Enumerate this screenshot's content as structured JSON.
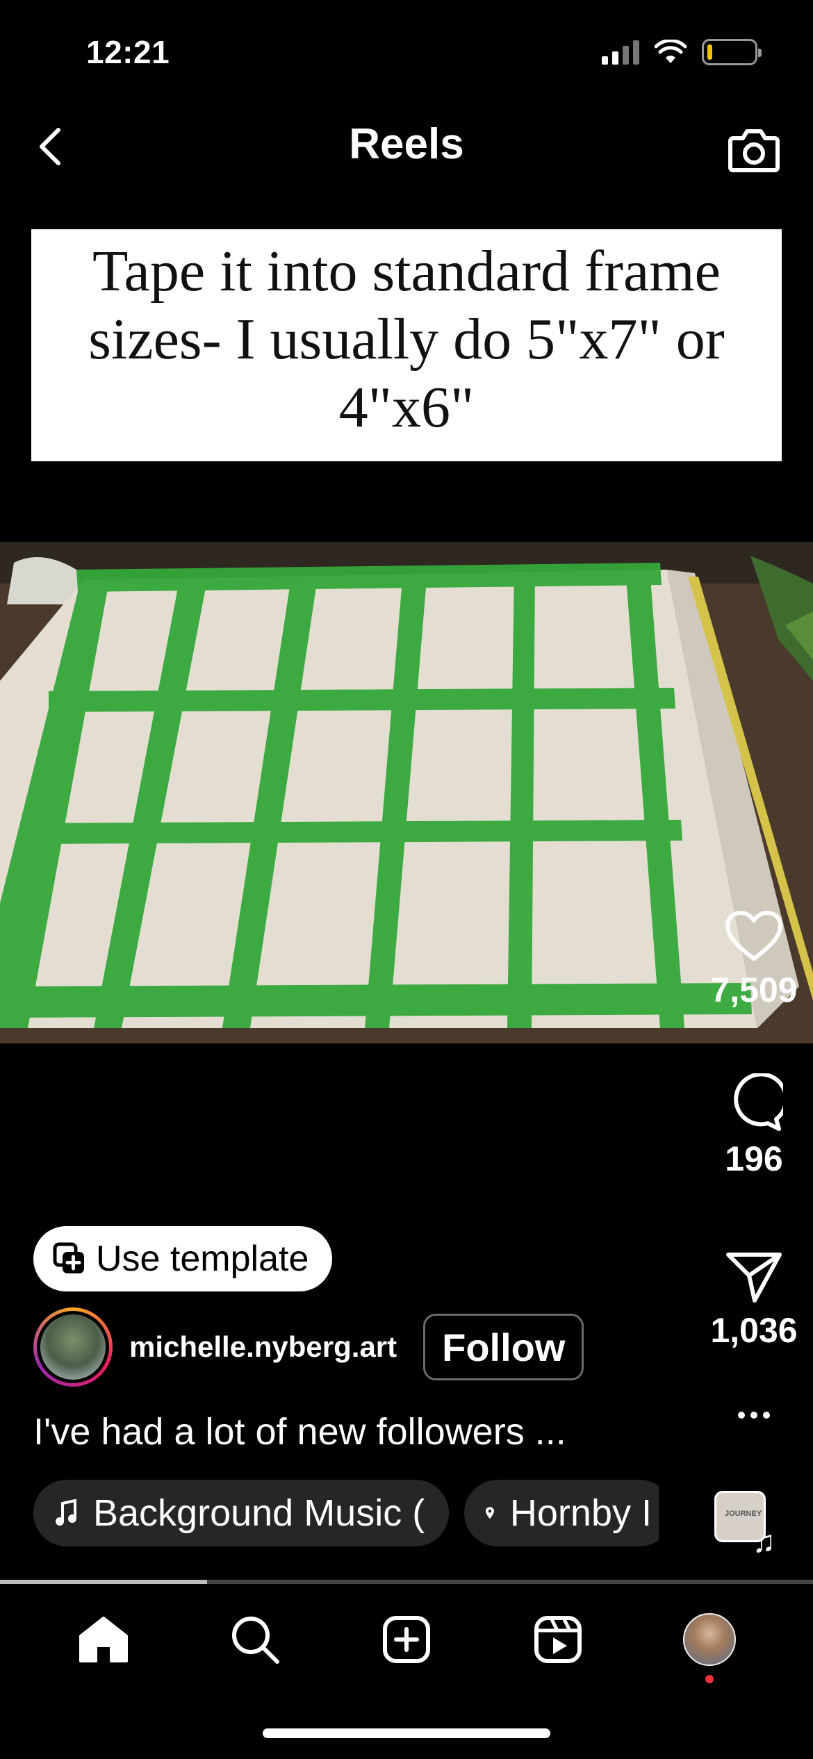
{
  "status_bar": {
    "time": "12:21"
  },
  "header": {
    "title": "Reels"
  },
  "video": {
    "caption_overlay": "Tape it into standard frame sizes- I usually do 5\"x7\" or 4\"x6\""
  },
  "actions": {
    "likes": "7,509",
    "comments": "196",
    "shares": "1,036"
  },
  "template": {
    "label": "Use template"
  },
  "author": {
    "username": "michelle.nyberg.art",
    "follow_label": "Follow"
  },
  "description": "I've had a lot of new followers ...",
  "chips": {
    "music": "Background Music (",
    "location": "Hornby I"
  },
  "audio_thumb": {
    "text": "JOURNEY"
  },
  "playback": {
    "progress": 0.255
  },
  "tabs": [
    "home",
    "search",
    "create",
    "reels",
    "profile"
  ],
  "colors": {
    "background": "#000000",
    "tape": "#34a83a",
    "notification": "#ff3040"
  }
}
